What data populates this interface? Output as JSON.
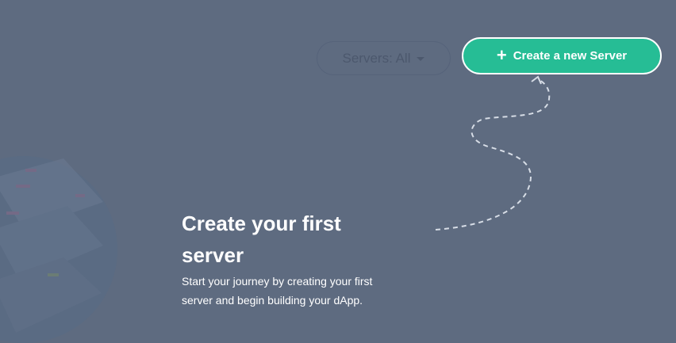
{
  "toolbar": {
    "filter_label": "Servers: All",
    "create_label": "Create a new Server"
  },
  "empty_state": {
    "title": "Create your first server",
    "description": "Start your journey by creating your first server and begin building your dApp."
  },
  "colors": {
    "background": "#5e6b80",
    "accent": "#26bd95",
    "text": "#ffffff"
  },
  "icons": {
    "create": "plus-icon",
    "filter": "caret-down-icon"
  }
}
